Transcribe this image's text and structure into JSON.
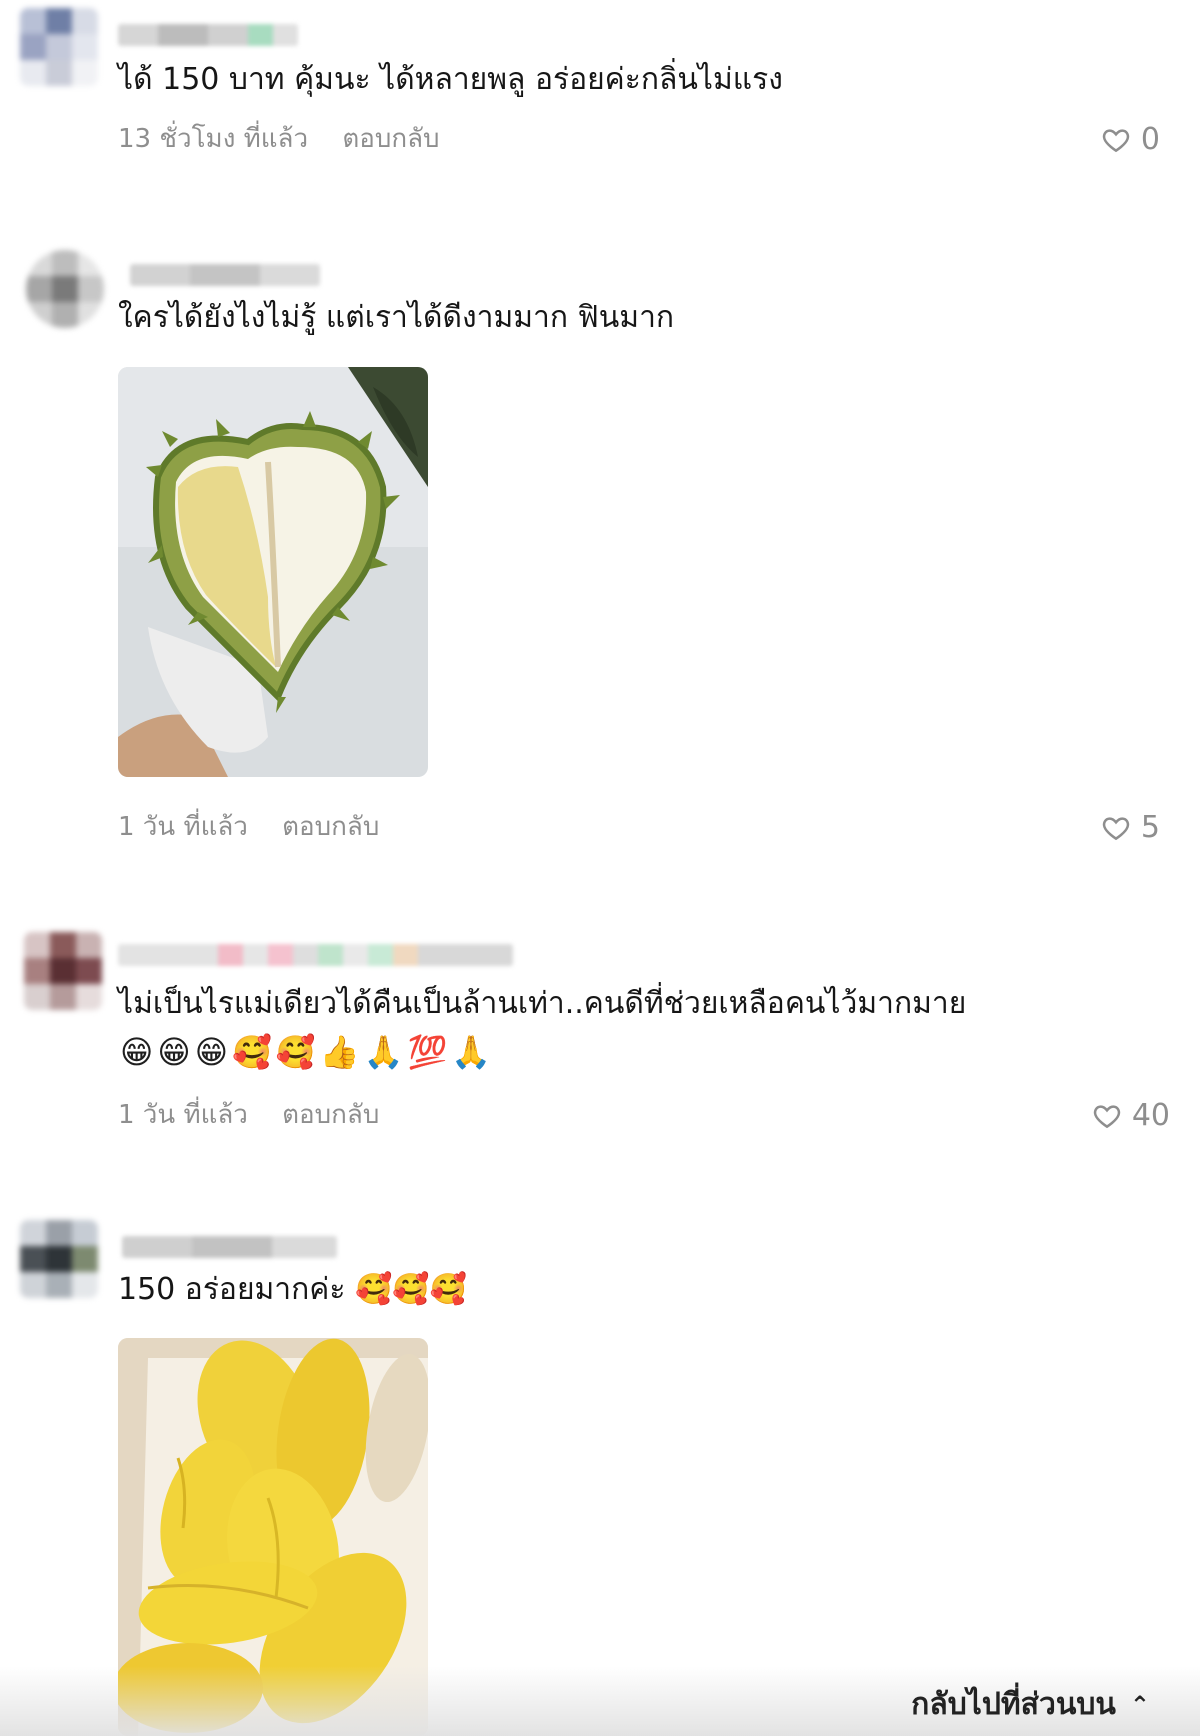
{
  "comments": [
    {
      "text": "ได้ 150 บาท คุ้มนะ ได้หลายพลู อร่อยค่ะกลิ่นไม่แรง",
      "time": "13 ชั่วโมง ที่แล้ว",
      "reply": "ตอบกลับ",
      "likes": "0"
    },
    {
      "text": "ใครได้ยังไงไม่รู้ แต่เราได้ดีงามมาก ฟินมาก",
      "time": "1 วัน ที่แล้ว",
      "reply": "ตอบกลับ",
      "likes": "5"
    },
    {
      "text": "ไม่เป็นไรแม่เดียวได้คืนเป็นล้านเท่า..คนดีที่ช่วยเหลือคนไว้มากมาย",
      "emojis": "😁😁😁🥰🥰👍🙏💯🙏",
      "time": "1 วัน ที่แล้ว",
      "reply": "ตอบกลับ",
      "likes": "40"
    },
    {
      "text": "150 อร่อยมากค่ะ 🥰🥰🥰"
    }
  ],
  "back_to_top": "กลับไปที่ส่วนบน",
  "icons": {
    "like": "heart-outline-icon",
    "back_to_top": "double-chevron-up-icon"
  },
  "colors": {
    "meta_text": "#8e8e8e",
    "durian_flesh": "#f2d43a"
  }
}
